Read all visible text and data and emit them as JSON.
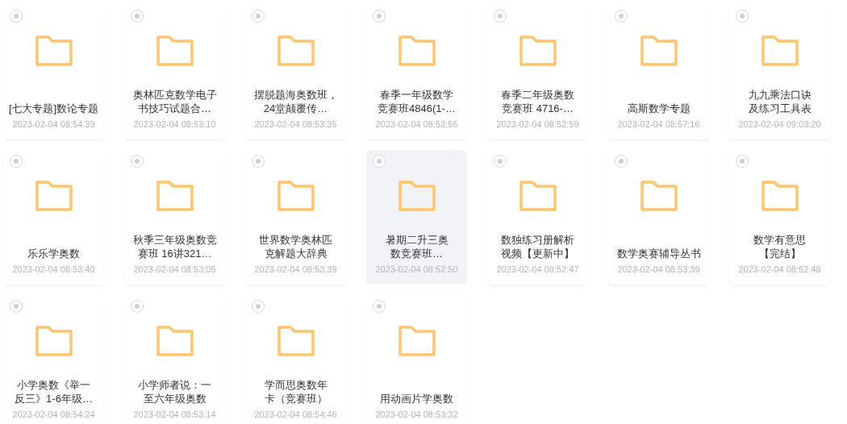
{
  "folders": [
    {
      "name": "[七大专题]数论专题",
      "date": "2023-02-04 08:54:39",
      "selected": false,
      "hovered": false
    },
    {
      "name": "奥林匹克数学电子书技巧试题合…",
      "date": "2023-02-04 08:53:10",
      "selected": false,
      "hovered": false
    },
    {
      "name": "摆脱题海奥数班，24堂颠覆传…",
      "date": "2023-02-04 08:53:35",
      "selected": false,
      "hovered": false
    },
    {
      "name": "春季一年级数学竞赛班4846(1-…",
      "date": "2023-02-04 08:52:55",
      "selected": false,
      "hovered": false
    },
    {
      "name": "春季二年级奥数竞赛班 4716-…",
      "date": "2023-02-04 08:52:59",
      "selected": false,
      "hovered": false
    },
    {
      "name": "高斯数学专题",
      "date": "2023-02-04 08:57:16",
      "selected": false,
      "hovered": false
    },
    {
      "name": "九九乘法口诀及练习工具表",
      "date": "2023-02-04 09:03:20",
      "selected": false,
      "hovered": false
    },
    {
      "name": "乐乐学奥数",
      "date": "2023-02-04 08:53:40",
      "selected": false,
      "hovered": false
    },
    {
      "name": "秋季三年级奥数竞赛班 16讲321…",
      "date": "2023-02-04 08:53:05",
      "selected": false,
      "hovered": false
    },
    {
      "name": "世界数学奥林匹克解题大辞典",
      "date": "2023-02-04 08:53:39",
      "selected": false,
      "hovered": false
    },
    {
      "name": "暑期二升三奥数竞赛班…",
      "date": "2023-02-04 08:52:50",
      "selected": false,
      "hovered": true
    },
    {
      "name": "数独练习册解析视频【更新中】",
      "date": "2023-02-04 08:52:47",
      "selected": false,
      "hovered": false
    },
    {
      "name": "数学奥赛辅导丛书",
      "date": "2023-02-04 08:53:39",
      "selected": false,
      "hovered": false
    },
    {
      "name": "数学有意思【完结】",
      "date": "2023-02-04 08:52:48",
      "selected": false,
      "hovered": false
    },
    {
      "name": "小学奥数《举一反三》1-6年级…",
      "date": "2023-02-04 08:54:24",
      "selected": false,
      "hovered": false
    },
    {
      "name": "小学师者说：一至六年级奥数",
      "date": "2023-02-04 08:53:14",
      "selected": false,
      "hovered": false
    },
    {
      "name": "学而思奥数年卡（竞赛班）",
      "date": "2023-02-04 08:54:46",
      "selected": false,
      "hovered": false
    },
    {
      "name": "用动画片学奥数",
      "date": "2023-02-04 08:53:32",
      "selected": false,
      "hovered": false
    }
  ]
}
